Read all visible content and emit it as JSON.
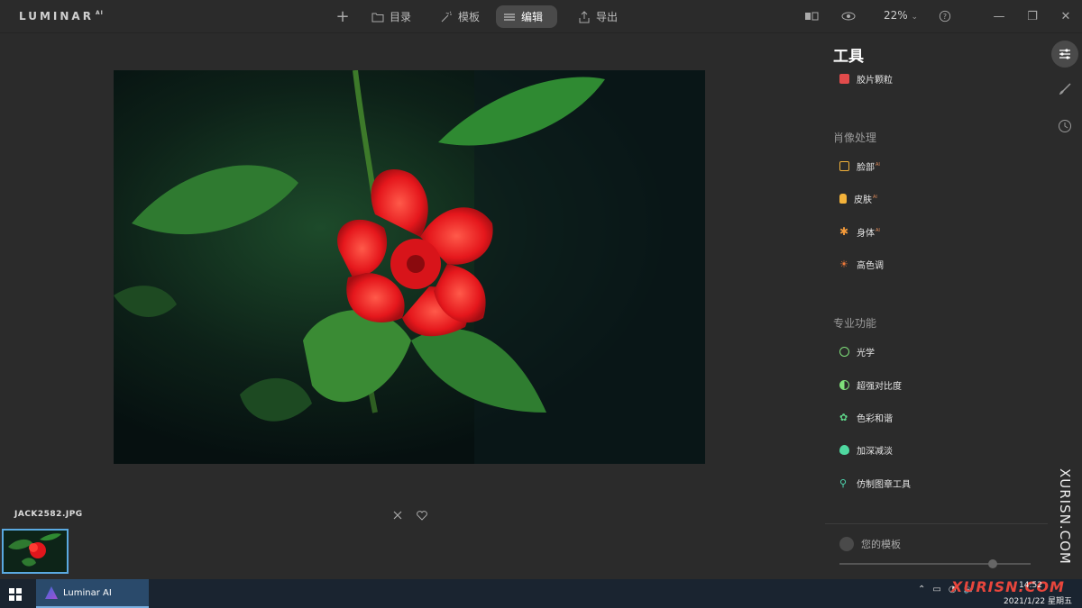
{
  "app": {
    "logo": "LUMINAR",
    "logo_sup": "AI"
  },
  "topbar": {
    "catalog_label": "目录",
    "templates_label": "模板",
    "edit_label": "编辑",
    "export_label": "导出",
    "zoom": "22%"
  },
  "photo": {
    "filename": "JACK2582.JPG"
  },
  "panel": {
    "title": "工具",
    "items_top": [
      {
        "label": "胶片颗粒",
        "ai": "",
        "color": "#e14b4b",
        "icon": "film-grain-icon"
      }
    ],
    "portrait_section": "肖像处理",
    "portrait_items": [
      {
        "label": "脸部",
        "ai": "AI",
        "color": "#f3b23a",
        "icon": "face-icon"
      },
      {
        "label": "皮肤",
        "ai": "AI",
        "color": "#f3b23a",
        "icon": "skin-icon"
      },
      {
        "label": "身体",
        "ai": "AI",
        "color": "#f39a3a",
        "icon": "body-icon"
      },
      {
        "label": "高色调",
        "ai": "",
        "color": "#f07a3a",
        "icon": "high-key-icon"
      }
    ],
    "pro_section": "专业功能",
    "pro_items": [
      {
        "label": "光学",
        "ai": "",
        "color": "#7fe07a",
        "icon": "optics-icon"
      },
      {
        "label": "超强对比度",
        "ai": "",
        "color": "#7fe07a",
        "icon": "supercontrast-icon"
      },
      {
        "label": "色彩和谐",
        "ai": "",
        "color": "#5fd88a",
        "icon": "color-harmony-icon"
      },
      {
        "label": "加深减淡",
        "ai": "",
        "color": "#4fd8a0",
        "icon": "dodge-burn-icon"
      },
      {
        "label": "仿制图章工具",
        "ai": "",
        "color": "#4fd8b0",
        "icon": "clone-stamp-icon"
      }
    ],
    "templates_label": "您的模板"
  },
  "watermark": "XURISN.COM",
  "watermark2": "XURISN.COM",
  "taskbar": {
    "app_label": "Luminar AI",
    "time": "14:52",
    "date": "2021/1/22 星期五"
  }
}
